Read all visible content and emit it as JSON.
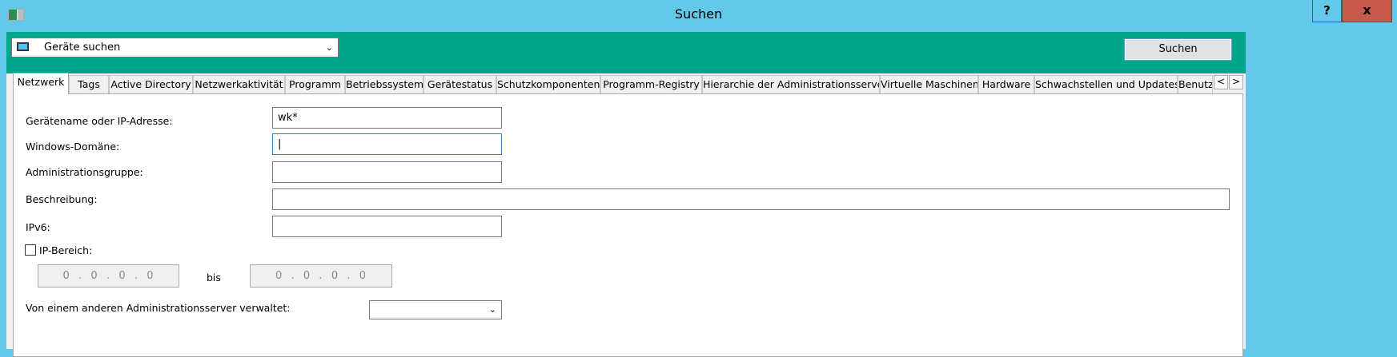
{
  "window": {
    "title": "Suchen",
    "help": "?",
    "close": "x"
  },
  "toolbar": {
    "mode": "Geräte suchen",
    "search_button": "Suchen"
  },
  "tabs": [
    "Netzwerk",
    "Tags",
    "Active Directory",
    "Netzwerkaktivität",
    "Programm",
    "Betriebssystem",
    "Gerätestatus",
    "Schutzkomponenten",
    "Programm-Registry",
    "Hierarchie der Administrationsserver",
    "Virtuelle Maschinen",
    "Hardware",
    "Schwachstellen und Updates",
    "Benutz"
  ],
  "tab_scroll": {
    "left": "<",
    "right": ">"
  },
  "form": {
    "device_label": "Gerätename oder IP-Adresse:",
    "device_value": "wk*",
    "domain_label": "Windows-Domäne:",
    "domain_value": "|",
    "group_label": "Administrationsgruppe:",
    "group_value": "",
    "description_label": "Beschreibung:",
    "description_value": "",
    "ipv6_label": "IPv6:",
    "ipv6_value": "",
    "ip_range_label": "IP-Bereich:",
    "ip_range_checked": false,
    "ip_from": "0  .  0  .  0  .  0",
    "ip_to_label": "bis",
    "ip_to": "0  .  0  .  0  .  0",
    "other_server_label": "Von einem anderen Administrationsserver verwaltet:",
    "other_server_value": ""
  }
}
